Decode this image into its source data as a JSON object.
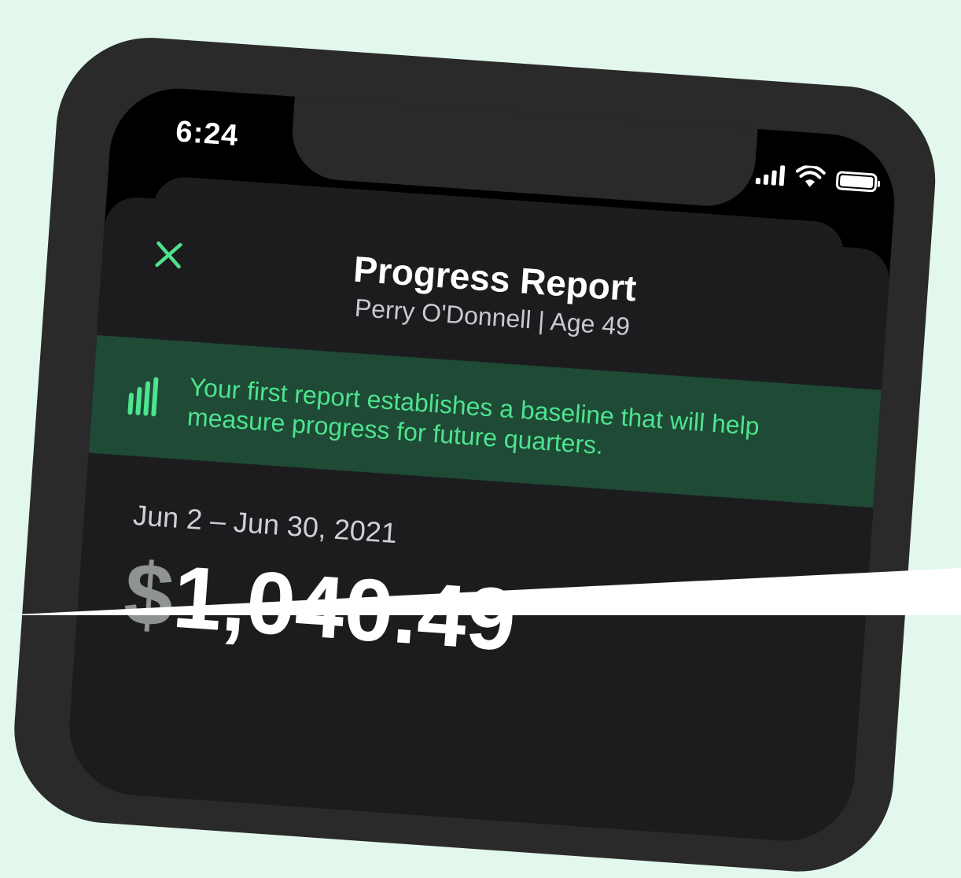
{
  "status_bar": {
    "time": "6:24",
    "icons": [
      "signal-icon",
      "wifi-icon",
      "battery-icon"
    ]
  },
  "header": {
    "close_icon": "close-icon",
    "title": "Progress Report",
    "subtitle": "Perry O'Donnell | Age 49"
  },
  "banner": {
    "icon": "bar-chart-icon",
    "text": "Your first report establishes a baseline that will help measure progress for future quarters."
  },
  "summary": {
    "date_range": "Jun 2 – Jun 30, 2021",
    "amount_currency": "$",
    "amount_value": "1,040.49"
  },
  "colors": {
    "accent": "#4ee38e",
    "banner_bg": "#1e4a36",
    "sheet_bg": "#1c1c1e",
    "page_bg": "#e3f8ec",
    "device_frame": "#2a2a2b"
  }
}
